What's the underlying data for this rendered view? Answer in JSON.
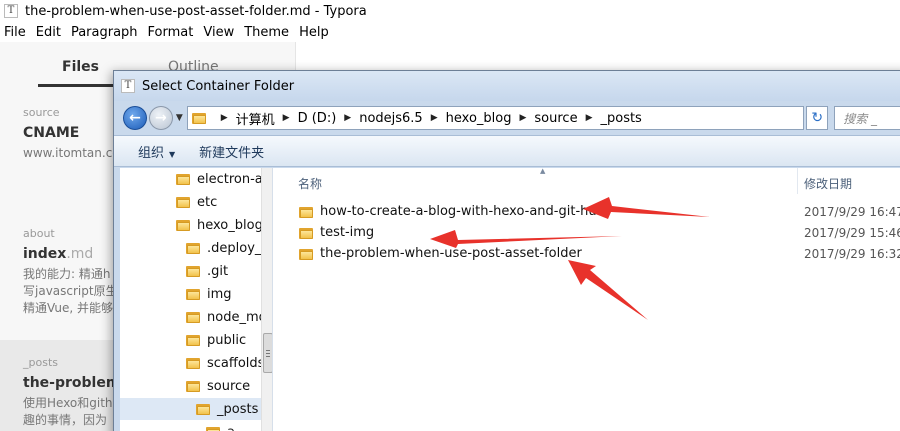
{
  "app": {
    "title": "the-problem-when-use-post-asset-folder.md - Typora",
    "icon_letter": "T"
  },
  "menu": [
    "File",
    "Edit",
    "Paragraph",
    "Format",
    "View",
    "Theme",
    "Help"
  ],
  "sidebar": {
    "tabs": [
      "Files",
      "Outline"
    ],
    "active_tab": "Files",
    "entries": [
      {
        "folder": "source",
        "name": "CNAME",
        "ext": "",
        "desc": [
          "www.itomtan.co"
        ]
      },
      {
        "folder": "about",
        "name": "index",
        "ext": ".md",
        "desc": [
          "我的能力: 精通h",
          "写javascript原生",
          "精通Vue, 并能够"
        ]
      },
      {
        "folder": "_posts",
        "name": "the-problem-w",
        "ext": "",
        "desc": [
          "使用Hexo和github",
          "趣的事情，因为"
        ]
      }
    ]
  },
  "dialog": {
    "title": "Select Container Folder",
    "icon_letter": "T",
    "back_icon": "back-arrow-icon",
    "forward_icon": "forward-arrow-icon",
    "breadcrumb": [
      "计算机",
      "D (D:)",
      "nodejs6.5",
      "hexo_blog",
      "source",
      "_posts"
    ],
    "search_placeholder": "搜索 _",
    "toolbar": {
      "organize": "组织",
      "new_folder": "新建文件夹"
    },
    "tree": [
      {
        "label": "electron-a",
        "indent": 1,
        "selected": false
      },
      {
        "label": "etc",
        "indent": 1,
        "selected": false
      },
      {
        "label": "hexo_blog",
        "indent": 1,
        "selected": false
      },
      {
        "label": ".deploy_",
        "indent": 2,
        "selected": false
      },
      {
        "label": ".git",
        "indent": 2,
        "selected": false
      },
      {
        "label": "img",
        "indent": 2,
        "selected": false
      },
      {
        "label": "node_mo",
        "indent": 2,
        "selected": false
      },
      {
        "label": "public",
        "indent": 2,
        "selected": false
      },
      {
        "label": "scaffolds",
        "indent": 2,
        "selected": false
      },
      {
        "label": "source",
        "indent": 2,
        "selected": false
      },
      {
        "label": "_posts",
        "indent": 3,
        "selected": true
      },
      {
        "label": "a",
        "indent": 4,
        "selected": false
      }
    ],
    "columns": {
      "name": "名称",
      "date": "修改日期"
    },
    "files": [
      {
        "name": "how-to-create-a-blog-with-hexo-and-git-hub",
        "date": "2017/9/29 16:47"
      },
      {
        "name": "test-img",
        "date": "2017/9/29 15:46"
      },
      {
        "name": "the-problem-when-use-post-asset-folder",
        "date": "2017/9/29 16:32"
      }
    ]
  },
  "annotation_color": "#e8322b"
}
